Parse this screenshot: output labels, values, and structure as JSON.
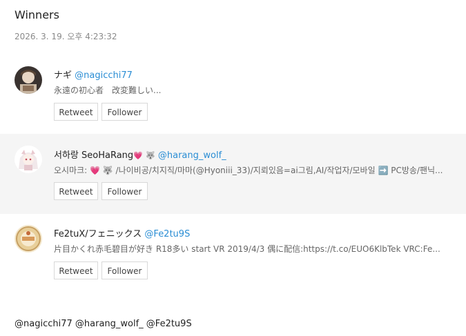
{
  "page": {
    "title": "Winners",
    "timestamp": "2026. 3. 19. 오후 4:23:32"
  },
  "winners": [
    {
      "name": "ナギ",
      "handle": "@nagicchi77",
      "bio": "永遠の初心者　改変難しい...",
      "retweet_label": "Retweet",
      "follower_label": "Follower",
      "avatar_icon": "avatar-anime-character-dark"
    },
    {
      "name": "서하랑 SeoHaRang",
      "name_emojis": [
        "💗",
        "🐺"
      ],
      "handle": "@harang_wolf_",
      "bio": "오시마크: 💗 🐺 /나이비공/치지직/마마(@Hyoniii_33)/지뢰있음=ai그림,AI/작업자/모바일 ➡️ PC방송/팬닉...",
      "retweet_label": "Retweet",
      "follower_label": "Follower",
      "avatar_icon": "avatar-anime-character-white"
    },
    {
      "name": "Fe2tuX/フェニックス",
      "handle": "@Fe2tu9S",
      "bio": "片目かくれ赤毛碧目が好き R18多い start VR 2019/4/3 偶に配信:https://t.co/EUO6KlbTek VRC:Fe...",
      "retweet_label": "Retweet",
      "follower_label": "Follower",
      "avatar_icon": "avatar-round-badge"
    }
  ],
  "footer": {
    "mentions": "@nagicchi77 @harang_wolf_ @Fe2tu9S"
  },
  "colors": {
    "handle": "#2a8dd4",
    "shaded_row": "#f5f5f5"
  }
}
